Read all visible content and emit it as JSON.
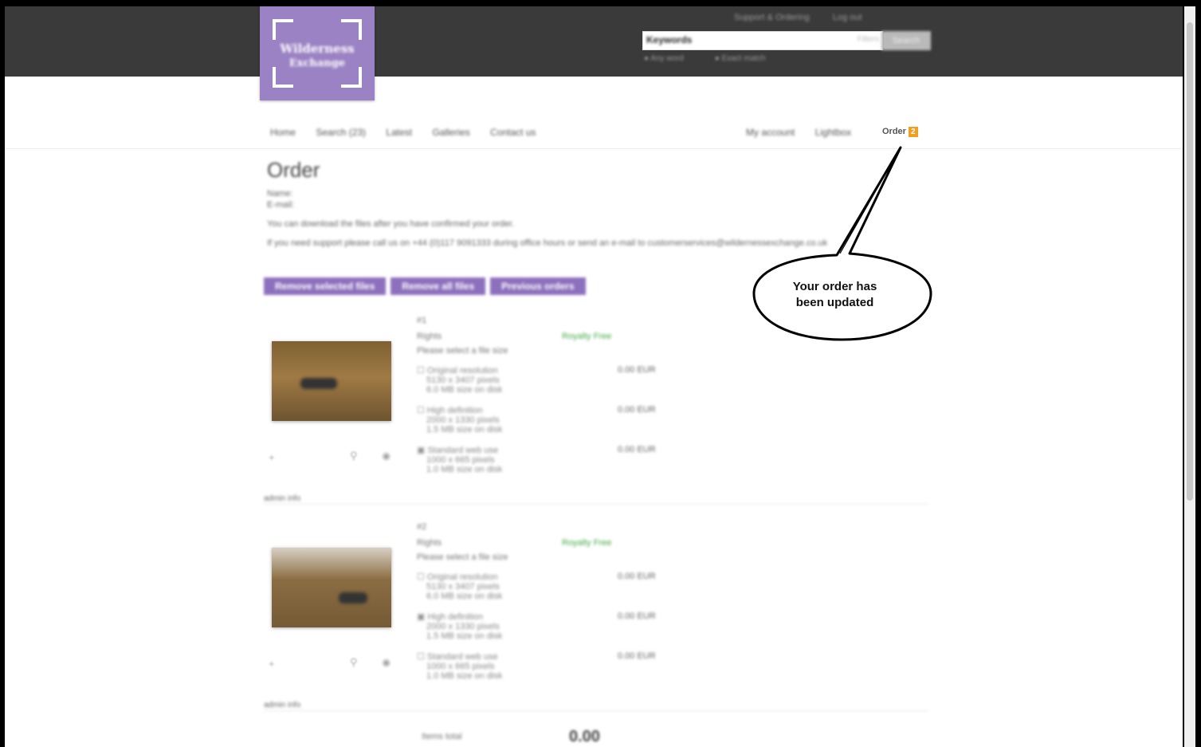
{
  "header": {
    "logo_line1": "Wilderness",
    "logo_line2": "Exchange",
    "toplinks": [
      "Support & Ordering",
      "Log out"
    ],
    "search_term": "Keywords",
    "search_option": "Filters",
    "search_button": "Search",
    "search_options": [
      "Any word",
      "Exact match"
    ]
  },
  "nav": {
    "left": [
      "Home",
      "Search (23)",
      "Latest",
      "Galleries",
      "Contact us"
    ],
    "right": [
      "My account",
      "Lightbox"
    ],
    "order_label": "Order",
    "order_count": "2"
  },
  "order": {
    "title": "Order",
    "info_lines": [
      "Name:",
      "E-mail:"
    ],
    "note1": "You can download the files after you have confirmed your order.",
    "note2": "If you need support please call us on +44 (0)117 9091333 during office hours or send an e-mail to customerservices@wildernessexchange.co.uk",
    "buttons": [
      "Remove selected files",
      "Remove all files",
      "Previous orders"
    ],
    "items": [
      {
        "id": "#1",
        "rights_label": "Rights",
        "rights_value": "Royalty Free",
        "select_prompt": "Please select a file size",
        "options": [
          {
            "name": "Original resolution",
            "dims": "5130 x 3407 pixels",
            "size": "6.0 MB size on disk",
            "price": "0.00 EUR"
          },
          {
            "name": "High definition",
            "dims": "2000 x 1330 pixels",
            "size": "1.5 MB size on disk",
            "price": "0.00 EUR"
          },
          {
            "name": "Standard web use",
            "dims": "1000 x 665 pixels",
            "size": "1.0 MB size on disk",
            "price": "0.00 EUR"
          }
        ],
        "footer": "admin info"
      },
      {
        "id": "#2",
        "rights_label": "Rights",
        "rights_value": "Royalty Free",
        "select_prompt": "Please select a file size",
        "options": [
          {
            "name": "Original resolution",
            "dims": "5130 x 3407 pixels",
            "size": "6.0 MB size on disk",
            "price": "0.00 EUR"
          },
          {
            "name": "High definition",
            "dims": "2000 x 1330 pixels",
            "size": "1.5 MB size on disk",
            "price": "0.00 EUR"
          },
          {
            "name": "Standard web use",
            "dims": "1000 x 665 pixels",
            "size": "1.0 MB size on disk",
            "price": "0.00 EUR"
          }
        ],
        "footer": "admin info"
      }
    ],
    "total_label": "Items total",
    "total_value": "0.00"
  },
  "callout": {
    "line1": "Your order has",
    "line2": "been updated"
  },
  "colors": {
    "header_bg": "#3a3a3a",
    "brand_purple": "#9b82c4",
    "button_purple": "#8d70bd",
    "badge_orange": "#f0a020",
    "rights_green": "#44aa44"
  }
}
